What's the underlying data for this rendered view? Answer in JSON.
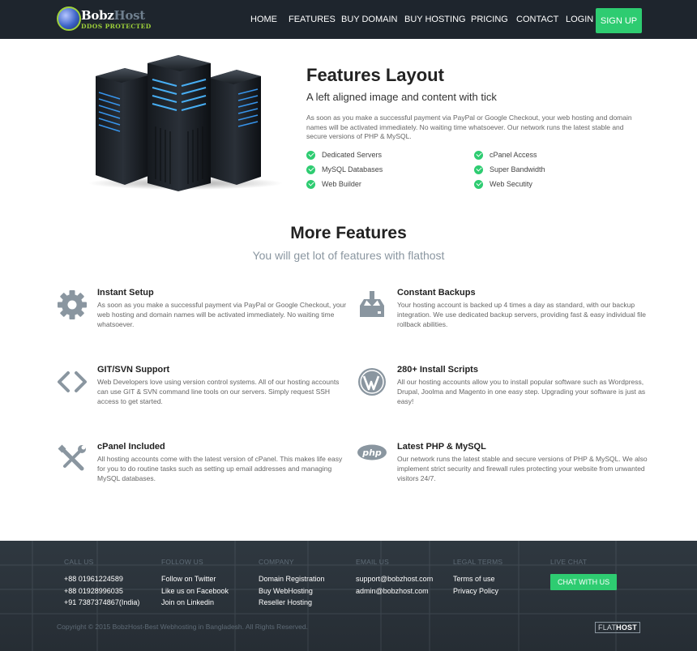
{
  "brand": {
    "name_first": "Bobz",
    "name_second": "Host",
    "tagline": "DDOS PROTECTED"
  },
  "nav": {
    "items": [
      "HOME",
      "FEATURES",
      "BUY DOMAIN",
      "BUY HOSTING",
      "PRICING",
      "CONTACT",
      "LOGIN"
    ],
    "signup": "SIGN UP"
  },
  "features_layout": {
    "title": "Features Layout",
    "subtitle": "A left aligned image and content with tick",
    "body": "As soon as you make a successful payment via PayPal or Google Checkout, your web hosting and domain names will be activated immediately. No waiting time whatsoever. Our network runs the latest stable and secure versions of PHP & MySQL.",
    "ticks": [
      "Dedicated Servers",
      "cPanel Access",
      "MySQL Databases",
      "Super Bandwidth",
      "Web Builder",
      "Web Secutity"
    ]
  },
  "more_features": {
    "title": "More Features",
    "subtitle": "You will get lot of features with flathost",
    "items": [
      {
        "icon": "gear-icon",
        "title": "Instant Setup",
        "body": "As soon as you make a successful payment via PayPal or Google Checkout, your web hosting and domain names will be activated immediately. No waiting time whatsoever."
      },
      {
        "icon": "backup-tray-icon",
        "title": "Constant Backups",
        "body": "Your hosting account is backed up 4 times a day as standard, with our backup integration. We use dedicated backup servers, providing fast & easy individual file rollback abilities."
      },
      {
        "icon": "code-icon",
        "title": "GIT/SVN Support",
        "body": "Web Developers love using version control systems. All of our hosting accounts can use GIT & SVN command line tools on our servers. Simply request SSH access to get started."
      },
      {
        "icon": "wordpress-icon",
        "title": "280+ Install Scripts",
        "body": "All our hosting accounts allow you to install popular software such as Wordpress, Drupal, Joolma and Magento in one easy step. Upgrading your software is just as easy!"
      },
      {
        "icon": "tools-icon",
        "title": "cPanel Included",
        "body": "All hosting accounts come with the latest version of cPanel. This makes life easy for you to do routine tasks such as setting up email addresses and managing MySQL databases."
      },
      {
        "icon": "php-icon",
        "title": "Latest PHP & MySQL",
        "body": "Our network runs the latest stable and secure versions of PHP & MySQL. We also implement strict security and firewall rules protecting your website from unwanted visitors 24/7."
      }
    ]
  },
  "footer": {
    "columns": [
      {
        "heading": "CALL US",
        "items": [
          "+88 01961224589",
          "+88 01928996035",
          "+91 7387374867(India)"
        ]
      },
      {
        "heading": "FOLLOW US",
        "items": [
          "Follow on Twitter",
          "Like us on Facebook",
          "Join on Linkedin"
        ]
      },
      {
        "heading": "COMPANY",
        "items": [
          "Domain Registration",
          "Buy WebHosting",
          "Reseller Hosting"
        ]
      },
      {
        "heading": "EMAIL US",
        "items": [
          "support@bobzhost.com",
          "admin@bobzhost.com"
        ]
      },
      {
        "heading": "LEGAL TERMS",
        "items": [
          "Terms of use",
          "Privacy Policy"
        ]
      },
      {
        "heading": "LIVE CHAT",
        "items": []
      }
    ],
    "chat_button": "CHAT WITH US",
    "copyright": "Copyright © 2015 BobzHost-Best Webhosting in Bangladesh. All Rights Reserved.",
    "badge_first": "FLAT",
    "badge_second": "HOST"
  },
  "colors": {
    "accent": "#2ecc71",
    "navbar": "#1e252d",
    "footer": "#2b333b",
    "icon_gray": "#8a96a0"
  }
}
